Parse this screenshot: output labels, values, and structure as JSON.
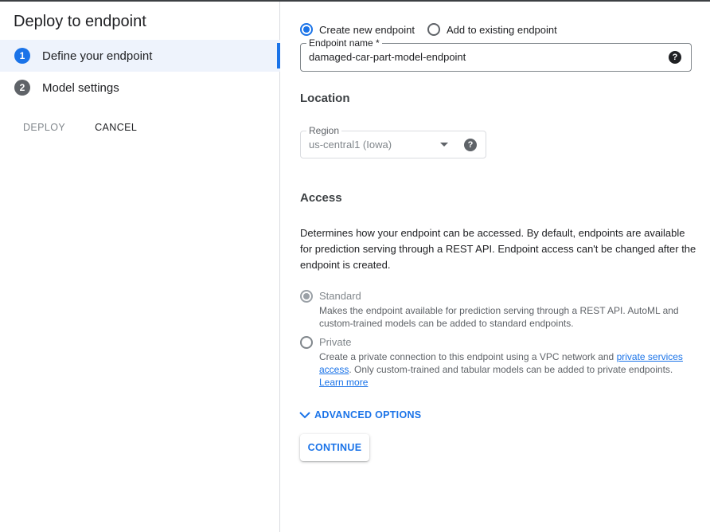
{
  "left": {
    "title": "Deploy to endpoint",
    "steps": [
      {
        "num": "1",
        "label": "Define your endpoint",
        "active": true
      },
      {
        "num": "2",
        "label": "Model settings",
        "active": false
      }
    ],
    "deploy_label": "DEPLOY",
    "cancel_label": "CANCEL"
  },
  "endpoint": {
    "create_new_label": "Create new endpoint",
    "add_existing_label": "Add to existing endpoint",
    "name_legend": "Endpoint name *",
    "name_value": "damaged-car-part-model-endpoint"
  },
  "location": {
    "heading": "Location",
    "region_legend": "Region",
    "region_value": "us-central1 (Iowa)"
  },
  "access": {
    "heading": "Access",
    "description": "Determines how your endpoint can be accessed. By default, endpoints are available for prediction serving through a REST API. Endpoint access can't be changed after the endpoint is created.",
    "standard_title": "Standard",
    "standard_desc": "Makes the endpoint available for prediction serving through a REST API. AutoML and custom-trained models can be added to standard endpoints.",
    "private_title": "Private",
    "private_desc_before": "Create a private connection to this endpoint using a VPC network and ",
    "private_link": "private services access",
    "private_desc_after": ". Only custom-trained and tabular models can be added to private endpoints. ",
    "learn_more": "Learn more"
  },
  "advanced_label": "ADVANCED OPTIONS",
  "continue_label": "CONTINUE",
  "colors": {
    "accent": "#1a73e8",
    "active_step_bg": "#eef3fc",
    "step_inactive": "#5f6368"
  },
  "icons": {
    "help": "help-circle-icon",
    "dropdown": "arrow-drop-down-icon",
    "expand": "chevron-down-icon"
  }
}
